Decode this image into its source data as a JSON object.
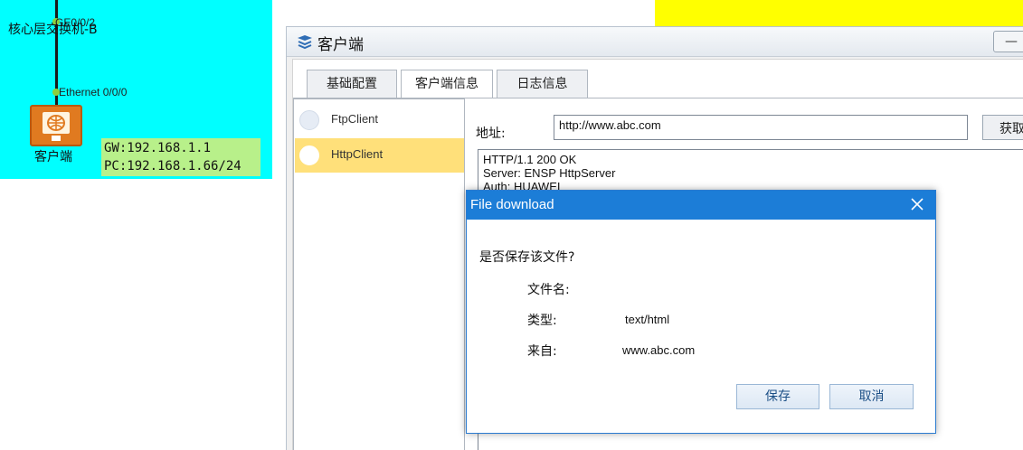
{
  "topology": {
    "switch_port": "GE0/0/2",
    "switch_label": "核心层交换机-B",
    "pc_port": "Ethernet 0/0/0",
    "pc_label": "客户端",
    "gw_line": "GW:192.168.1.1",
    "pc_line": "PC:192.168.1.66/24",
    "background_color": "#00ffff"
  },
  "window": {
    "title": "客户端",
    "min_label": "—",
    "tabs": [
      {
        "label": "基础配置",
        "active": false
      },
      {
        "label": "客户端信息",
        "active": true
      },
      {
        "label": "日志信息",
        "active": false
      }
    ],
    "clients": [
      {
        "label": "FtpClient",
        "selected": false
      },
      {
        "label": "HttpClient",
        "selected": true
      }
    ],
    "address_label": "地址:",
    "address_value": "http://www.abc.com",
    "get_button_label": "获取",
    "response_text": "HTTP/1.1 200 OK\nServer: ENSP HttpServer\nAuth: HUAWEI"
  },
  "dialog": {
    "title": "File download",
    "question": "是否保存该文件?",
    "filename_label": "文件名:",
    "filename_value": "",
    "type_label": "类型:",
    "type_value": "text/html",
    "from_label": "来自:",
    "from_value": "www.abc.com",
    "save_label": "保存",
    "cancel_label": "取消",
    "accent_color": "#1c7dd7"
  }
}
